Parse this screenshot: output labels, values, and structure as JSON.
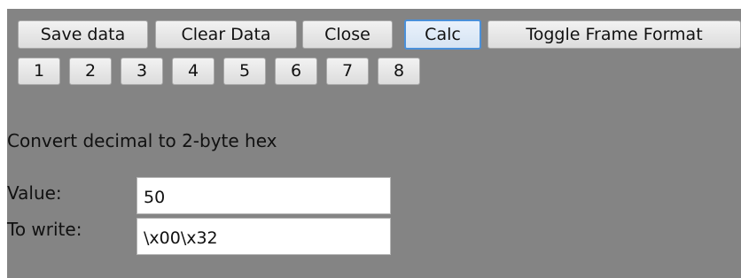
{
  "toolbar": {
    "save_label": "Save data",
    "clear_label": "Clear Data",
    "close_label": "Close",
    "calc_label": "Calc",
    "toggle_label": "Toggle Frame Format"
  },
  "frames": [
    "1",
    "2",
    "3",
    "4",
    "5",
    "6",
    "7",
    "8"
  ],
  "calc": {
    "heading": "Convert decimal to 2-byte hex",
    "value_label": "Value:",
    "value": "50",
    "write_label": "To write:",
    "write_value": "\\x00\\x32"
  },
  "colors": {
    "panel_background": "#848484",
    "active_border": "#4a90d9"
  }
}
